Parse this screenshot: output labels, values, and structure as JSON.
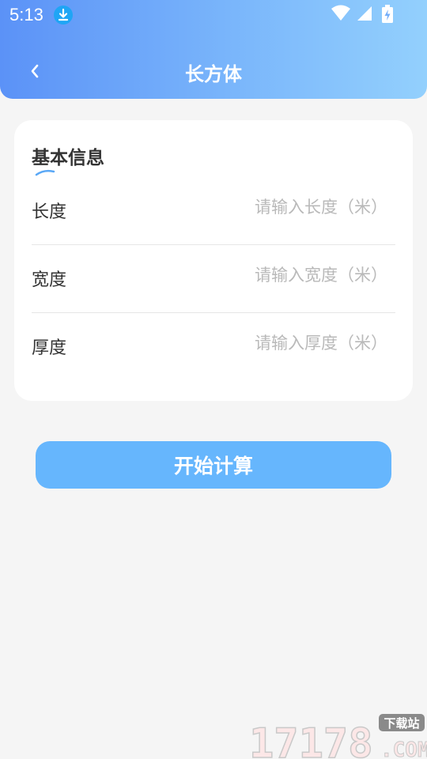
{
  "status_bar": {
    "time": "5:13",
    "icons": [
      "download-icon",
      "wifi-icon",
      "signal-icon",
      "battery-charging-icon"
    ]
  },
  "header": {
    "title": "长方体",
    "back_icon": "chevron-left-icon",
    "gradient_colors": [
      "#5b92f7",
      "#93d0fd"
    ]
  },
  "card": {
    "title": "基本信息",
    "fields": [
      {
        "label": "长度",
        "value": "",
        "placeholder": "请输入长度（米）"
      },
      {
        "label": "宽度",
        "value": "",
        "placeholder": "请输入宽度（米）"
      },
      {
        "label": "厚度",
        "value": "",
        "placeholder": "请输入厚度（米）"
      }
    ]
  },
  "actions": {
    "start_label": "开始计算",
    "button_color": "#66b6fd"
  },
  "watermark": {
    "number": "17178",
    "domain": ".COM",
    "tag": "下载站"
  }
}
